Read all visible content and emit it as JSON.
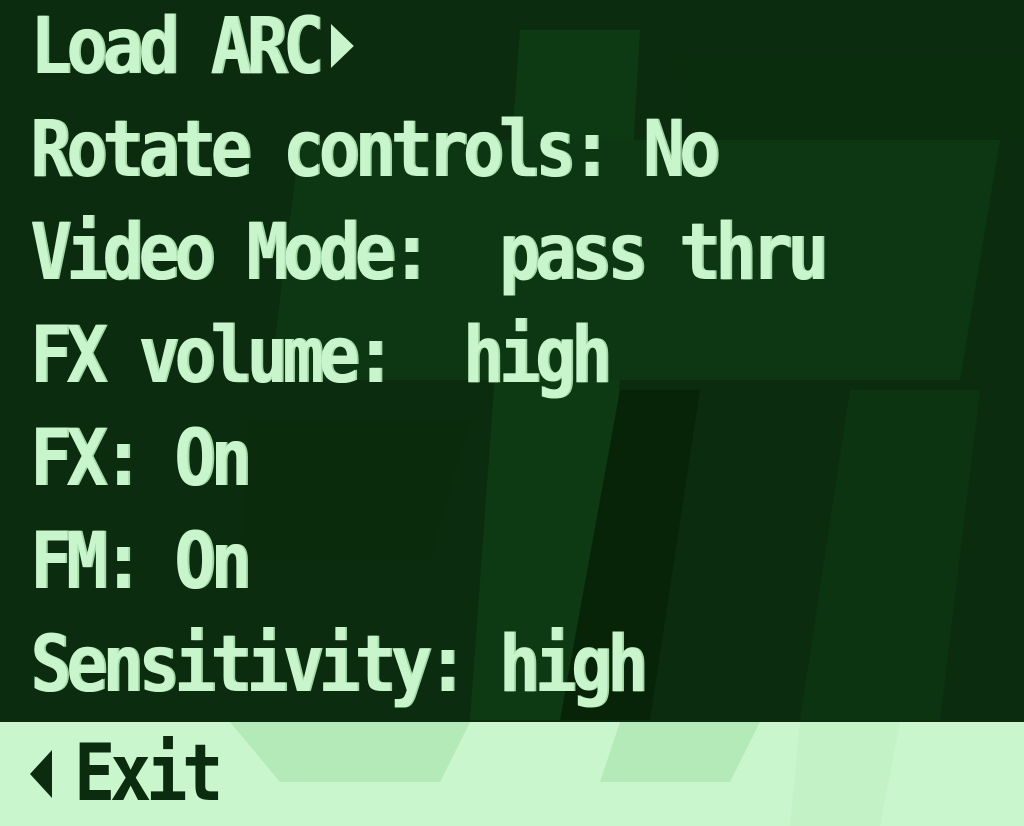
{
  "menu": {
    "items": [
      {
        "label": "Load ARC",
        "has_submenu_arrow": true
      },
      {
        "label": "Rotate controls: No"
      },
      {
        "label": "Video Mode:  pass thru"
      },
      {
        "label": "FX volume:  high"
      },
      {
        "label": "FX: On"
      },
      {
        "label": "FM: On"
      },
      {
        "label": "Sensitivity: high"
      }
    ],
    "exit_label": "Exit",
    "selected_item": "Exit"
  },
  "colors": {
    "background": "#0b2c0f",
    "logo_shape": "#0f3d14",
    "logo_shape_dark": "#072008",
    "text": "#c9f5cc",
    "selection_bar": "#caf6cd",
    "selection_text": "#0b2c0f"
  },
  "icons": {
    "load_arc_arrow": "triangle-right-icon",
    "exit_arrow": "triangle-left-icon"
  }
}
